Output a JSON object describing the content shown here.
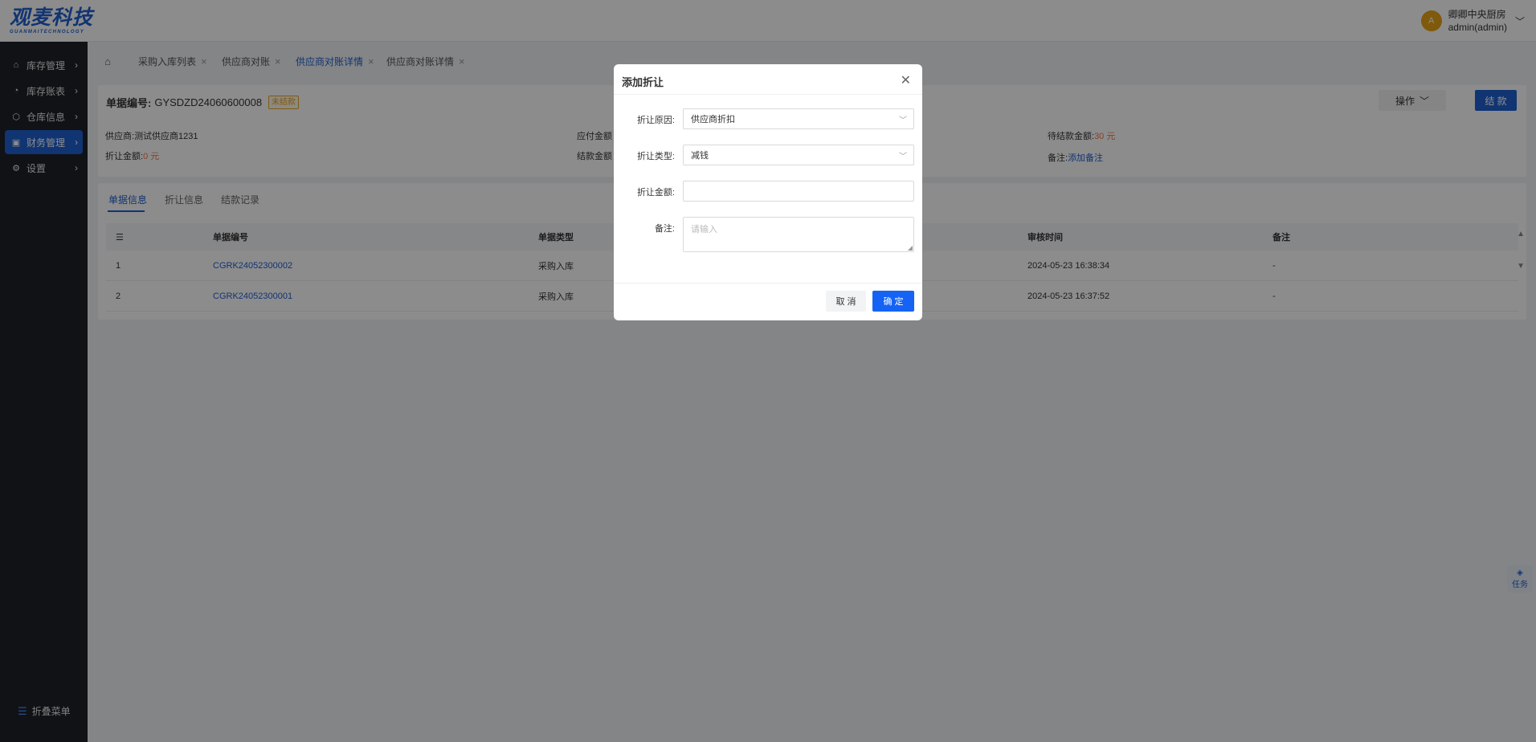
{
  "header": {
    "logo_main": "观麦科技",
    "logo_sub": "GUANMAITECHNOLOGY",
    "avatar_letter": "A",
    "user_name": "卿卿中央厨房",
    "user_account": "admin(admin)"
  },
  "sidebar": {
    "items": [
      {
        "label": "库存管理",
        "icon": "home-icon"
      },
      {
        "label": "库存账表",
        "icon": "chart-icon"
      },
      {
        "label": "仓库信息",
        "icon": "box-icon"
      },
      {
        "label": "财务管理",
        "icon": "finance-icon",
        "active": true
      },
      {
        "label": "设置",
        "icon": "gear-icon"
      }
    ],
    "collapse_label": "折叠菜单"
  },
  "tabs": [
    {
      "label": "采购入库列表"
    },
    {
      "label": "供应商对账"
    },
    {
      "label": "供应商对账详情",
      "active": true
    },
    {
      "label": "供应商对账详情"
    }
  ],
  "summary": {
    "doc_label": "单据编号:",
    "doc_no": "GYSDZD24060600008",
    "status_badge": "未结款",
    "op_button": "操作",
    "settle_button": "结 款",
    "supplier_label": "供应商:",
    "supplier_value": "测试供应商1231",
    "payable_label": "应付金额",
    "pending_label": "待结款金额:",
    "pending_value": "30 元",
    "discount_label": "折让金额:",
    "discount_value": "0 元",
    "settled_label": "结款金额",
    "remark_label": "备注:",
    "remark_link": "添加备注"
  },
  "detail": {
    "subtabs": [
      "单据信息",
      "折让信息",
      "结款记录"
    ],
    "columns": [
      "单据编号",
      "单据类型",
      "审核时间",
      "备注"
    ],
    "rows": [
      {
        "idx": "1",
        "doc_no": "CGRK24052300002",
        "type": "采购入库",
        "audit_time": "2024-05-23 16:38:34",
        "remark": "-"
      },
      {
        "idx": "2",
        "doc_no": "CGRK24052300001",
        "type": "采购入库",
        "audit_time": "2024-05-23 16:37:52",
        "remark": "-"
      }
    ]
  },
  "task_float": "任务",
  "modal": {
    "title": "添加折让",
    "reason_label": "折让原因:",
    "reason_value": "供应商折扣",
    "type_label": "折让类型:",
    "type_value": "减钱",
    "amount_label": "折让金额:",
    "amount_value": "",
    "remark_label": "备注:",
    "remark_placeholder": "请输入",
    "cancel_label": "取 消",
    "ok_label": "确 定"
  }
}
